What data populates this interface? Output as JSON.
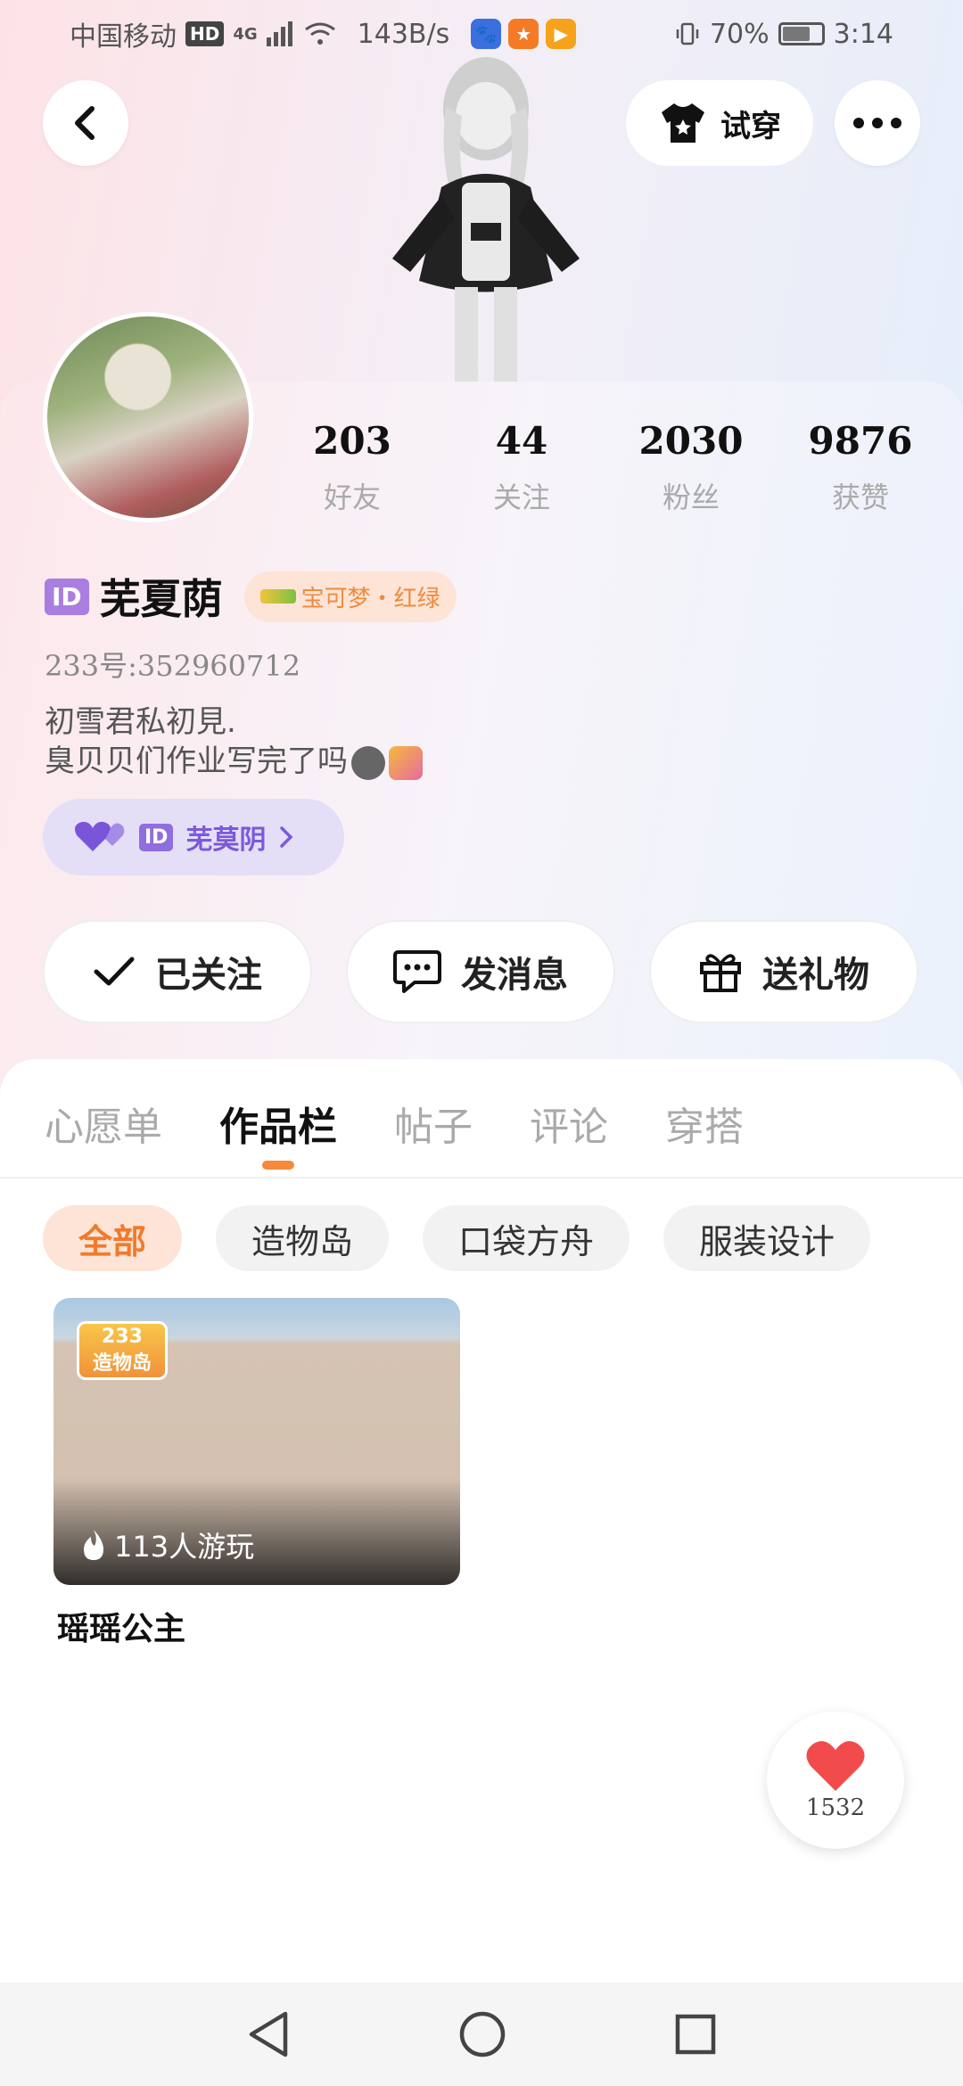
{
  "status_bar": {
    "carrier": "中国移动",
    "hd": "HD",
    "network": "4G",
    "speed": "143B/s",
    "battery": "70%",
    "time": "3:14"
  },
  "header": {
    "try_on_label": "试穿"
  },
  "stats": [
    {
      "value": "203",
      "label": "好友"
    },
    {
      "value": "44",
      "label": "关注"
    },
    {
      "value": "2030",
      "label": "粉丝"
    },
    {
      "value": "9876",
      "label": "获赞"
    }
  ],
  "profile": {
    "id_badge": "ID",
    "name": "芜夏荫",
    "game_tag": "宝可梦・红绿",
    "uid": "233号:352960712",
    "bio_line1": "初雪君私初見.",
    "bio_line2": "臭贝贝们作业写完了吗",
    "partner_id_badge": "ID",
    "partner_name": "芜莫阴"
  },
  "actions": {
    "follow": "已关注",
    "message": "发消息",
    "gift": "送礼物"
  },
  "tabs": [
    "心愿单",
    "作品栏",
    "帖子",
    "评论",
    "穿搭"
  ],
  "active_tab": "作品栏",
  "filters": [
    "全部",
    "造物岛",
    "口袋方舟",
    "服装设计"
  ],
  "active_filter": "全部",
  "work": {
    "logo_line1": "233",
    "logo_line2": "造物岛",
    "plays": "113人游玩",
    "title": "瑶瑶公主"
  },
  "like_count": "1532",
  "colors": {
    "accent": "#f58a3c",
    "purple": "#7c59d9",
    "heart": "#f24b4b"
  }
}
